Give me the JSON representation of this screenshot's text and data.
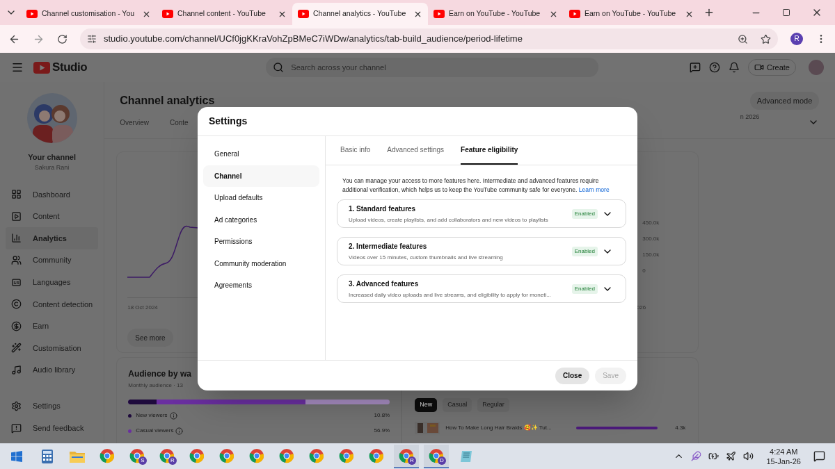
{
  "browser": {
    "tabs": [
      {
        "title": "Channel customisation - You",
        "selected": false
      },
      {
        "title": "Channel content - YouTube",
        "selected": false
      },
      {
        "title": "Channel analytics - YouTube",
        "selected": true
      },
      {
        "title": "Earn on YouTube - YouTube",
        "selected": false
      },
      {
        "title": "Earn on YouTube - YouTube",
        "selected": false
      }
    ],
    "url": "studio.youtube.com/channel/UCf0jgKKraVohZpBMeC7iWDw/analytics/tab-build_audience/period-lifetime",
    "profile": "R"
  },
  "studio": {
    "logo": "Studio",
    "search_placeholder": "Search across your channel",
    "create": "Create",
    "sidebar": {
      "channel_title": "Your channel",
      "channel_name": "Sakura Rani",
      "items": [
        {
          "label": "Dashboard",
          "selected": false
        },
        {
          "label": "Content",
          "selected": false
        },
        {
          "label": "Analytics",
          "selected": true
        },
        {
          "label": "Community",
          "selected": false
        },
        {
          "label": "Languages",
          "selected": false
        },
        {
          "label": "Content detection",
          "selected": false
        },
        {
          "label": "Earn",
          "selected": false
        },
        {
          "label": "Customisation",
          "selected": false
        },
        {
          "label": "Audio library",
          "selected": false
        }
      ],
      "bottom_items": [
        "Settings",
        "Send feedback"
      ]
    },
    "page": {
      "title": "Channel analytics",
      "advanced_mode": "Advanced mode",
      "tabs": [
        "Overview",
        "Conte"
      ],
      "date_range": "n 2026",
      "chart": {
        "yticks": [
          "450.0k",
          "300.0k",
          "150.0k",
          "0"
        ],
        "x_start": "18 Oct 2024",
        "x_end": "026"
      },
      "see_more": "See more",
      "audience": {
        "title": "Audience by wa",
        "subtitle": "Monthly audience · 13",
        "segments": [
          {
            "label": "New viewers",
            "value": "10.8%",
            "color": "#1e0a3c"
          },
          {
            "label": "Casual viewers",
            "value": "56.9%",
            "color": "#6a2fa0"
          }
        ]
      },
      "chips": [
        {
          "label": "New",
          "selected": true
        },
        {
          "label": "Casual",
          "selected": false
        },
        {
          "label": "Regular",
          "selected": false
        }
      ],
      "videos": [
        {
          "title": "How To Make Long Hair Braids 🥰✨ Tut...",
          "value": "4.3k",
          "level": 0.9
        }
      ]
    }
  },
  "modal": {
    "title": "Settings",
    "nav": [
      {
        "label": "General",
        "selected": false
      },
      {
        "label": "Channel",
        "selected": true
      },
      {
        "label": "Upload defaults",
        "selected": false
      },
      {
        "label": "Ad categories",
        "selected": false
      },
      {
        "label": "Permissions",
        "selected": false
      },
      {
        "label": "Community moderation",
        "selected": false
      },
      {
        "label": "Agreements",
        "selected": false
      }
    ],
    "tabs": [
      {
        "label": "Basic info",
        "selected": false
      },
      {
        "label": "Advanced settings",
        "selected": false
      },
      {
        "label": "Feature eligibility",
        "selected": true
      }
    ],
    "description": "You can manage your access to more features here. Intermediate and advanced features require additional verification, which helps us to keep the YouTube community safe for everyone.",
    "learn_more": "Learn more",
    "features": [
      {
        "title": "1. Standard features",
        "description": "Upload videos, create playlists, and add collaborators and new videos to playlists",
        "status": "Enabled"
      },
      {
        "title": "2. Intermediate features",
        "description": "Videos over 15 minutes, custom thumbnails and live streaming",
        "status": "Enabled"
      },
      {
        "title": "3. Advanced features",
        "description": "Increased daily video uploads and live streams, and eligibility to apply for moneti...",
        "status": "Enabled"
      }
    ],
    "close": "Close",
    "save": {
      "label": "Save",
      "disabled": true
    }
  },
  "taskbar": {
    "apps": [
      {
        "kind": "calculator"
      },
      {
        "kind": "folder"
      },
      {
        "kind": "chrome"
      },
      {
        "kind": "chrome",
        "badge": "S"
      },
      {
        "kind": "chrome",
        "badge": "R"
      },
      {
        "kind": "chrome"
      },
      {
        "kind": "chrome"
      },
      {
        "kind": "chrome"
      },
      {
        "kind": "chrome"
      },
      {
        "kind": "chrome"
      },
      {
        "kind": "chrome"
      },
      {
        "kind": "chrome"
      },
      {
        "kind": "chrome",
        "badge": "R",
        "active": true
      },
      {
        "kind": "chrome",
        "badge": "D",
        "active": true
      },
      {
        "kind": "notepad"
      }
    ],
    "time": "4:24 AM",
    "date": "15-Jan-26"
  }
}
